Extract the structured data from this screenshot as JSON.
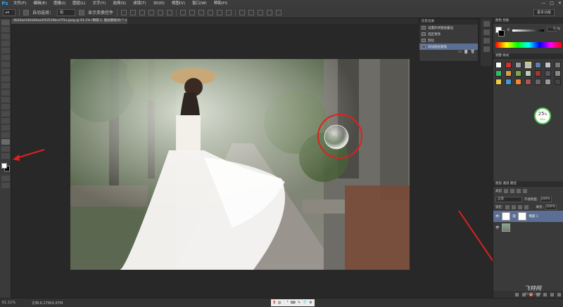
{
  "app": {
    "logo": "Ps"
  },
  "menubar": {
    "items": [
      "文件(F)",
      "编辑(E)",
      "图像(I)",
      "图层(L)",
      "文字(Y)",
      "选择(S)",
      "滤镜(T)",
      "3D(D)",
      "视图(V)",
      "窗口(W)",
      "帮助(H)"
    ],
    "window_controls": [
      "—",
      "□",
      "✕"
    ]
  },
  "options": {
    "auto_select_label": "自动选择：",
    "auto_select_value": "组",
    "show_transform_label": "显示变换控件",
    "workspace": "基本功能"
  },
  "document": {
    "tab_title": "4b24ae14b1b6aa2f43519bce7f1e.jpeg @ 61.1% (椭圆 1, 图层蒙版/8) *",
    "close_glyph": "×"
  },
  "history_panel": {
    "tabs": "历史记录",
    "items": [
      {
        "label": "设置形状图层蓄边",
        "active": false
      },
      {
        "label": "选区更改",
        "active": false
      },
      {
        "label": "羽化",
        "active": false
      },
      {
        "label": "添加图层蒙版",
        "active": true
      }
    ]
  },
  "color_panel": {
    "tabs": "颜色   色板",
    "k_label": "K",
    "k_value": "0",
    "k_unit": "%"
  },
  "styles_panel": {
    "tabs": "调整   样式"
  },
  "perf_widget": {
    "percent": "25",
    "unit": "%",
    "speed": "0K/s"
  },
  "layers_panel": {
    "tabs": "图层   通道   路径",
    "kind_label": "类型",
    "blend_mode": "正常",
    "opacity_label": "不透明度:",
    "opacity_value": "100%",
    "lock_label": "锁定:",
    "fill_label": "填充:",
    "fill_value": "100%",
    "layers": [
      {
        "name": "椭圆 1",
        "selected": true
      },
      {
        "name": "",
        "selected": false
      }
    ]
  },
  "statusbar": {
    "zoom": "61.11%",
    "doc_info": "文档:6.27M/6.87M",
    "ime_items": [
      "S",
      "中",
      "·",
      "°",
      "⌨",
      "✎",
      "👕",
      "⚙"
    ]
  },
  "watermark": {
    "main": "飞特网",
    "sub": "FEVTE.COM"
  },
  "colors": {
    "accent": "#2fa3f5",
    "history_active": "#5b6f95",
    "annotation_arrow": "#e02020",
    "perf_ring": "#4ec94e"
  }
}
